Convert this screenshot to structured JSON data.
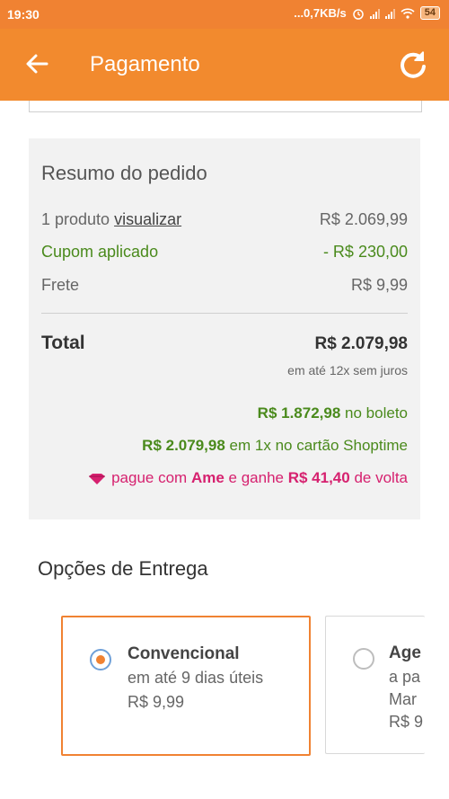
{
  "status_bar": {
    "time": "19:30",
    "network": "...0,7KB/s",
    "battery": "54"
  },
  "app_bar": {
    "title": "Pagamento"
  },
  "summary": {
    "title": "Resumo do pedido",
    "products_label": "1 produto",
    "view_link": "visualizar",
    "products_value": "R$ 2.069,99",
    "coupon_label": "Cupom aplicado",
    "coupon_value": "- R$ 230,00",
    "shipping_label": "Frete",
    "shipping_value": "R$ 9,99",
    "total_label": "Total",
    "total_value": "R$ 2.079,98",
    "installments": "em até 12x sem juros",
    "boleto_value": "R$ 1.872,98",
    "boleto_text": "no boleto",
    "card_value": "R$ 2.079,98",
    "card_text": "em 1x no cartão Shoptime",
    "ame_prefix": "pague com",
    "ame_brand": "Ame",
    "ame_middle": "e ganhe",
    "ame_value": "R$ 41,40",
    "ame_suffix": "de volta"
  },
  "delivery": {
    "title": "Opções de Entrega",
    "options": [
      {
        "name": "Convencional",
        "time": "em até 9 dias úteis",
        "price": "R$ 9,99",
        "selected": true
      },
      {
        "name": "Age",
        "time": "a pa",
        "line3": "Mar",
        "price": "R$ 9",
        "selected": false
      }
    ]
  },
  "colors": {
    "primary": "#f28a2e",
    "green": "#4a8a1c",
    "pink": "#d6216f"
  }
}
